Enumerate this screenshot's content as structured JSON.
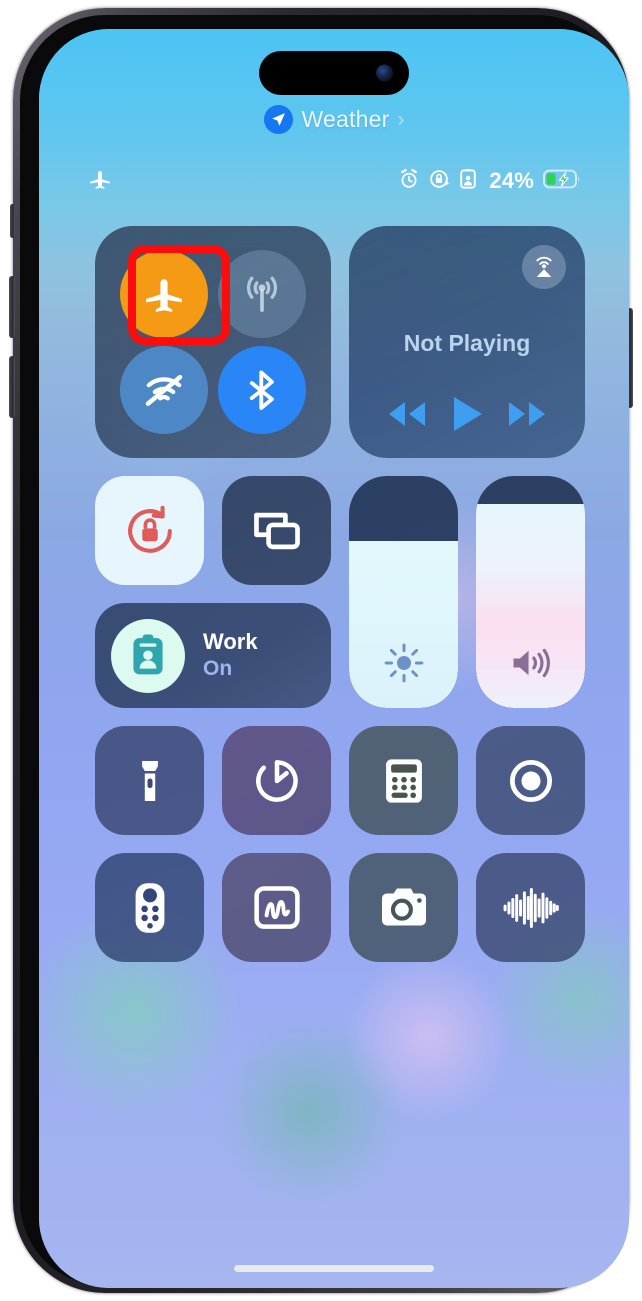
{
  "device": {
    "frame_color": "#2b2930",
    "screen_label": "iphone-screen"
  },
  "location_banner": {
    "icon": "location-arrow-icon",
    "label": "Weather",
    "chevron": "›",
    "badge_color": "#1577f2"
  },
  "status_bar": {
    "left_icons": [
      {
        "name": "airplane-mode-icon",
        "label": "Airplane Mode"
      }
    ],
    "right_icons": [
      {
        "name": "alarm-clock-icon",
        "label": "Alarm"
      },
      {
        "name": "rotation-lock-icon",
        "label": "Orientation Lock"
      },
      {
        "name": "focus-badge-icon",
        "label": "Focus"
      }
    ],
    "battery_percent": "24%",
    "battery_level": 24,
    "charging": true,
    "battery_fill_color": "#30d158"
  },
  "connectivity": {
    "module_name": "connectivity-module",
    "toggles": [
      {
        "name": "airplane-mode-toggle",
        "label": "Airplane Mode",
        "state": "on",
        "color": "#f59a14",
        "icon": "airplane-icon"
      },
      {
        "name": "cellular-data-toggle",
        "label": "Cellular Data",
        "state": "off",
        "color": "#7ba0be",
        "icon": "cellular-antenna-icon"
      },
      {
        "name": "wifi-toggle",
        "label": "Wi-Fi",
        "state": "off",
        "color": "#4e87c6",
        "icon": "wifi-slash-icon"
      },
      {
        "name": "bluetooth-toggle",
        "label": "Bluetooth",
        "state": "on",
        "color": "#2a86f7",
        "icon": "bluetooth-icon"
      }
    ]
  },
  "annotation": {
    "name": "red-highlight-box",
    "target": "airplane-mode-toggle",
    "color": "#fb0d0d",
    "stroke_width": 8
  },
  "media": {
    "module_name": "media-playback-module",
    "title": "Not Playing",
    "airplay_icon": "airplay-audio-icon",
    "controls": [
      {
        "name": "rewind-button",
        "label": "Rewind",
        "icon": "rewind-icon"
      },
      {
        "name": "play-button",
        "label": "Play",
        "icon": "play-icon"
      },
      {
        "name": "fast-forward-button",
        "label": "Fast Forward",
        "icon": "fast-forward-icon"
      }
    ],
    "accent_color": "#3e9ef0"
  },
  "toggles_row": [
    {
      "name": "rotation-lock-tile",
      "label": "Portrait Orientation Lock",
      "state": "on",
      "icon": "rotation-lock-icon",
      "accent": "#e05b5b"
    },
    {
      "name": "screen-mirroring-tile",
      "label": "Screen Mirroring",
      "state": "off",
      "icon": "screen-mirroring-icon",
      "accent": "#ffffff"
    }
  ],
  "focus": {
    "tile_name": "focus-mode-tile",
    "name": "Work",
    "state": "On",
    "icon": "focus-work-badge-icon",
    "icon_color": "#2fa5ad",
    "circle_color": "#dcfaf0"
  },
  "sliders": [
    {
      "name": "brightness-slider",
      "label": "Brightness",
      "value": 72,
      "icon": "sun-icon"
    },
    {
      "name": "volume-slider",
      "label": "Volume",
      "value": 88,
      "icon": "speaker-waves-icon"
    }
  ],
  "utilities": [
    [
      {
        "name": "flashlight-tile",
        "label": "Flashlight",
        "icon": "flashlight-icon"
      },
      {
        "name": "timer-tile",
        "label": "Timer",
        "icon": "timer-icon"
      },
      {
        "name": "calculator-tile",
        "label": "Calculator",
        "icon": "calculator-icon"
      },
      {
        "name": "screen-record-tile",
        "label": "Screen Record",
        "icon": "screen-record-icon"
      }
    ],
    [
      {
        "name": "apple-tv-remote-tile",
        "label": "Apple TV Remote",
        "icon": "tv-remote-icon"
      },
      {
        "name": "quick-note-tile",
        "label": "Quick Note",
        "icon": "quick-note-icon"
      },
      {
        "name": "camera-tile",
        "label": "Camera",
        "icon": "camera-icon"
      },
      {
        "name": "shazam-tile",
        "label": "Music Recognition",
        "icon": "sound-wave-icon"
      }
    ]
  ],
  "home_indicator": {
    "name": "home-indicator",
    "label": "Home Indicator"
  }
}
